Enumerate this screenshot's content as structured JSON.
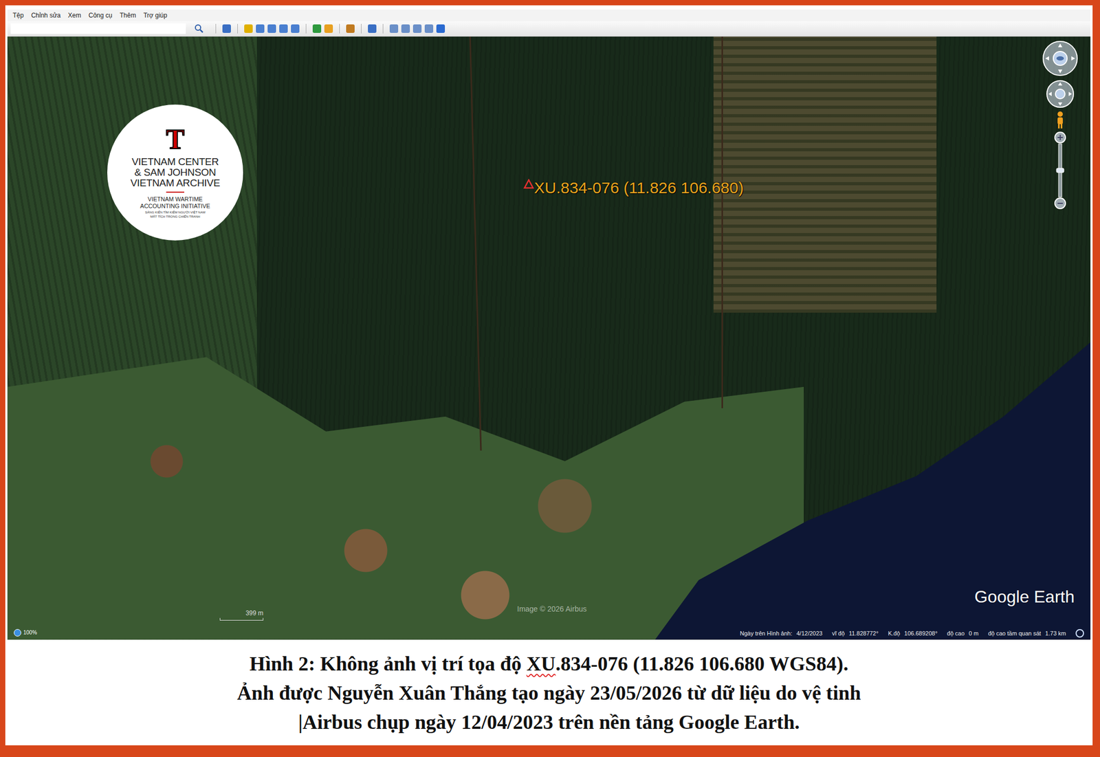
{
  "window": {
    "menu": [
      "Tệp",
      "Chỉnh sửa",
      "Xem",
      "Công cụ",
      "Thêm",
      "Trợ giúp"
    ]
  },
  "logo": {
    "mark": "T",
    "title": [
      "VIETNAM CENTER",
      "& SAM JOHNSON",
      "VIETNAM ARCHIVE"
    ],
    "subtitle": [
      "VIETNAM WARTIME",
      "ACCOUNTING INITIATIVE"
    ],
    "tagline": [
      "SÁNG KIẾN TÌM KIẾM NGƯỜI VIỆT NAM",
      "MẤT TÍCH TRONG CHIẾN TRANH"
    ]
  },
  "map": {
    "placemark": {
      "label": "XU.834-076 (11.826 106.680)"
    },
    "attribution": "Image © 2026 Airbus",
    "watermark": "Google Earth",
    "scale": "399 m",
    "loading": "100%",
    "status": [
      {
        "label": "Ngày trên Hình ảnh:",
        "value": "4/12/2023"
      },
      {
        "label": "vĩ độ",
        "value": "11.828772°"
      },
      {
        "label": "K.độ",
        "value": "106.689208°"
      },
      {
        "label": "độ cao",
        "value": "0 m"
      },
      {
        "label": "độ cao tầm quan sát",
        "value": "1.73 km"
      }
    ]
  },
  "caption": {
    "lines": [
      [
        {
          "text": "Hình 2: Không ảnh vị trí tọa độ ",
          "misspelled": false
        },
        {
          "text": "XU",
          "misspelled": true
        },
        {
          "text": ".834-076 (11.826 106.680 WGS84).",
          "misspelled": false
        }
      ],
      [
        {
          "text": "Ảnh được Nguyễn Xuân Thắng tạo ngày 23/05/2026 từ dữ liệu do vệ tinh",
          "misspelled": false
        }
      ],
      [
        {
          "text": "|Airbus chụp ngày 12/04/2023 trên nền tảng Google Earth.",
          "misspelled": false
        }
      ]
    ]
  }
}
